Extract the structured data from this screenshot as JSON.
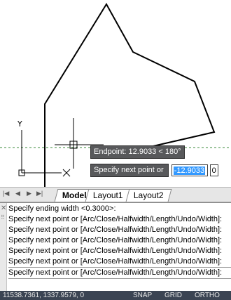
{
  "viewport": {
    "ucs_icon_axis_label": "Y",
    "dynamic_input": {
      "tooltip_text": "Endpoint: 12.9033 < 180°",
      "prompt_label": "Specify next point or",
      "distance_value": "-12.9033",
      "angle_value": "0"
    }
  },
  "tabs": {
    "nav_buttons": [
      "first-icon",
      "previous-icon",
      "next-icon",
      "last-icon"
    ],
    "items": [
      {
        "label": "Model",
        "active": true
      },
      {
        "label": "Layout1",
        "active": false
      },
      {
        "label": "Layout2",
        "active": false
      }
    ]
  },
  "command_line": {
    "lines": [
      "Specify ending width <0.3000>:",
      "Specify next point or [Arc/Close/Halfwidth/Length/Undo/Width]:",
      "Specify next point or [Arc/Close/Halfwidth/Length/Undo/Width]:",
      "Specify next point or [Arc/Close/Halfwidth/Length/Undo/Width]:",
      "Specify next point or [Arc/Close/Halfwidth/Length/Undo/Width]:",
      "Specify next point or [Arc/Close/Halfwidth/Length/Undo/Width]:",
      "Specify next point or [Arc/Close/Halfwidth/Length/Undo/Width]:"
    ]
  },
  "status_bar": {
    "coordinates": "11538.7361, 1337.9579, 0",
    "snap": "SNAP",
    "grid": "GRID",
    "ortho": "ORTHO"
  },
  "colors": {
    "canvas": "#ffffff",
    "tooltip_bg": "#58595b",
    "selection": "#3399ff",
    "status_bg": "#3b4453",
    "tracking_line": "#3a8a3a"
  }
}
